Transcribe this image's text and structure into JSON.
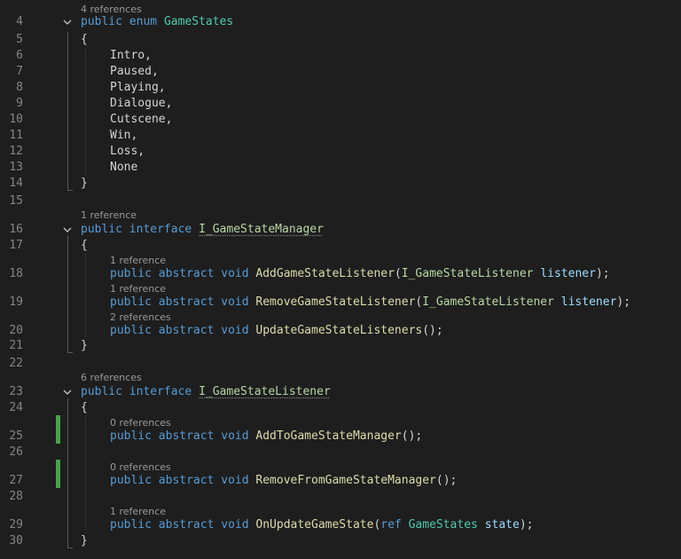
{
  "code_lens": {
    "game_states": "4 references",
    "game_state_manager": "1 reference",
    "add_listener": "1 reference",
    "remove_listener": "1 reference",
    "update_listeners": "2 references",
    "game_state_listener": "6 references",
    "add_to_manager": "0 references",
    "remove_from_manager": "0 references",
    "on_update": "1 reference"
  },
  "line_numbers": [
    "4",
    "5",
    "6",
    "7",
    "8",
    "9",
    "10",
    "11",
    "12",
    "13",
    "14",
    "15",
    "16",
    "17",
    "18",
    "19",
    "20",
    "21",
    "22",
    "23",
    "24",
    "25",
    "26",
    "27",
    "28",
    "29",
    "30"
  ],
  "tokens": {
    "public": "public",
    "enum": "enum",
    "interface": "interface",
    "abstract": "abstract",
    "void": "void",
    "ref": "ref",
    "open_brace": "{",
    "close_brace": "}",
    "game_states": "GameStates",
    "i_game_state_manager": "I_GameStateManager",
    "i_game_state_listener": "I_GameStateListener",
    "enum_members": [
      "Intro,",
      "Paused,",
      "Playing,",
      "Dialogue,",
      "Cutscene,",
      "Win,",
      "Loss,",
      "None"
    ],
    "add_listener": "AddGameStateListener",
    "remove_listener": "RemoveGameStateListener",
    "update_listeners": "UpdateGameStateListeners",
    "add_to_manager": "AddToGameStateManager",
    "remove_from_manager": "RemoveFromGameStateManager",
    "on_update": "OnUpdateGameState",
    "listener_param": "listener",
    "state_param": "state",
    "open_paren": "(",
    "close_paren_semicolon": ");",
    "empty_call": "();"
  },
  "colors": {
    "background": "#1e1e1e",
    "keyword": "#569cd6",
    "type": "#4ec9b0",
    "interface": "#b8d7a3",
    "method": "#dcdcaa",
    "parameter": "#9cdcfe",
    "line_number": "#858585",
    "code_lens": "#999999",
    "changed_line_marker": "#48a348"
  }
}
